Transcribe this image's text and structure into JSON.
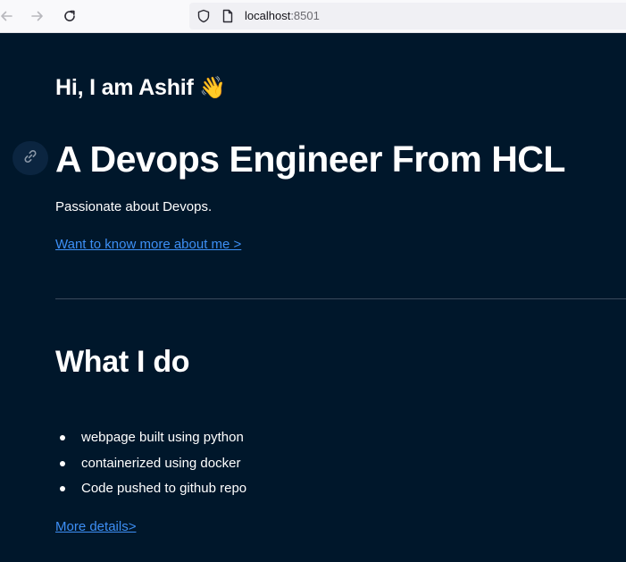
{
  "browser": {
    "url_host": "localhost",
    "url_port": ":8501",
    "icons": [
      "back-arrow-icon",
      "forward-arrow-icon",
      "reload-icon",
      "shield-icon",
      "page-icon"
    ]
  },
  "hero": {
    "greeting": "Hi, I am Ashif",
    "greeting_emoji": "👋",
    "title": "A Devops Engineer From HCL",
    "tagline": "Passionate about Devops.",
    "more_link": "Want to know more about me >"
  },
  "what_i_do": {
    "title": "What I do",
    "items": [
      "webpage built using python",
      "containerized using docker",
      "Code pushed to github repo"
    ],
    "details_link": "More details>"
  },
  "colors": {
    "app_background": "#00172b",
    "text": "#ffffff",
    "link": "#3d8ff5",
    "divider": "#3a4a5c",
    "browser_bar": "#f9f9fb",
    "url_box": "#f0f0f4"
  }
}
